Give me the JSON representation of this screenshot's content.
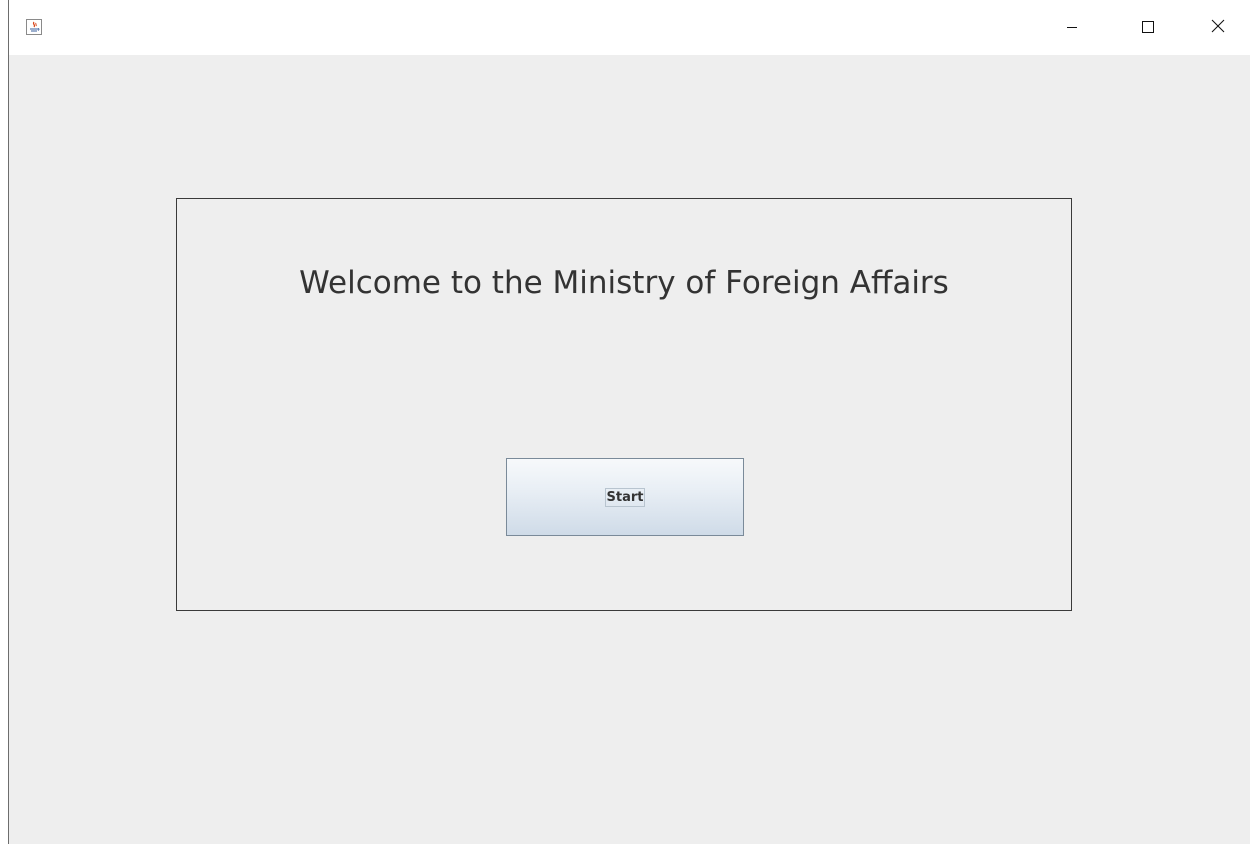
{
  "window": {
    "title": "",
    "controls": {
      "minimize_icon": "minimize-icon",
      "maximize_icon": "maximize-icon",
      "close_icon": "close-icon"
    },
    "app_icon": "java-icon"
  },
  "main": {
    "welcome_text": "Welcome to the Ministry of Foreign Affairs",
    "start_button_label": "Start"
  },
  "colors": {
    "background": "#eeeeee",
    "titlebar": "#ffffff",
    "panel_border": "#3a3a3a",
    "button_top": "#f7f9fb",
    "button_bottom": "#cfdbe8",
    "text": "#333333"
  }
}
